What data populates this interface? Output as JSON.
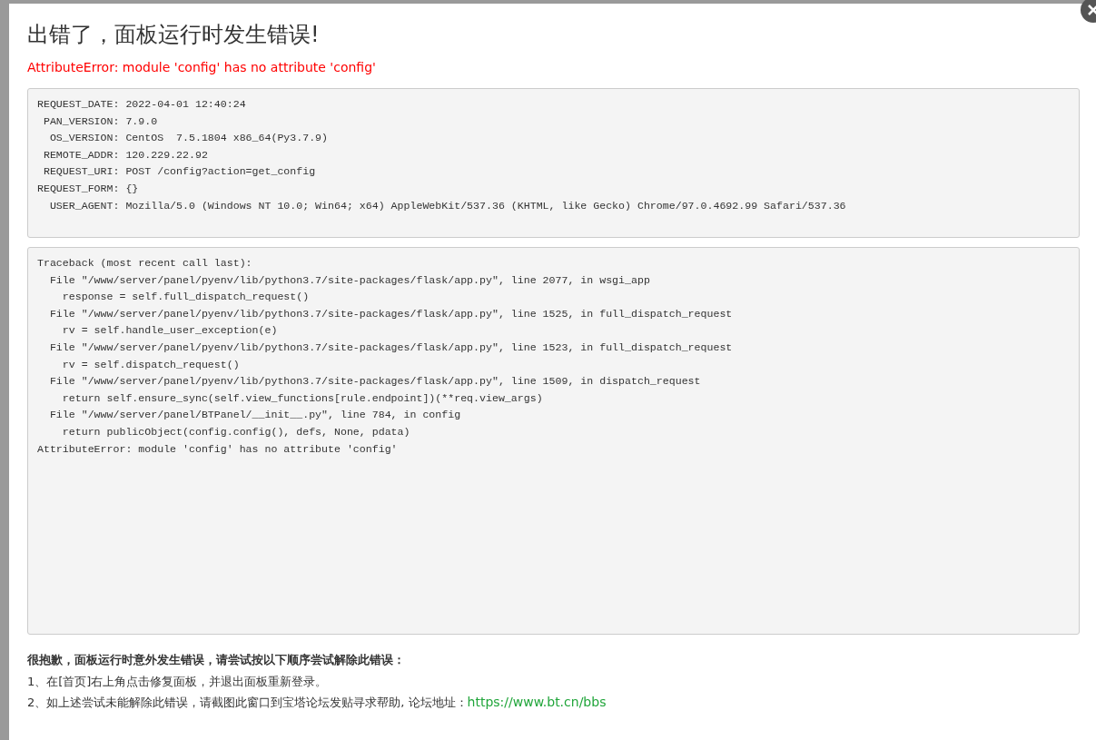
{
  "dialog": {
    "title": "出错了，面板运行时发生错误!",
    "error": "AttributeError: module 'config' has no attribute 'config'"
  },
  "request_info": [
    "REQUEST_DATE: 2022-04-01 12:40:24",
    " PAN_VERSION: 7.9.0",
    "  OS_VERSION: CentOS  7.5.1804 x86_64(Py3.7.9)",
    " REMOTE_ADDR: 120.229.22.92",
    " REQUEST_URI: POST /config?action=get_config",
    "REQUEST_FORM: {}",
    "  USER_AGENT: Mozilla/5.0 (Windows NT 10.0; Win64; x64) AppleWebKit/537.36 (KHTML, like Gecko) Chrome/97.0.4692.99 Safari/537.36"
  ],
  "traceback": [
    "Traceback (most recent call last):",
    "  File \"/www/server/panel/pyenv/lib/python3.7/site-packages/flask/app.py\", line 2077, in wsgi_app",
    "    response = self.full_dispatch_request()",
    "  File \"/www/server/panel/pyenv/lib/python3.7/site-packages/flask/app.py\", line 1525, in full_dispatch_request",
    "    rv = self.handle_user_exception(e)",
    "  File \"/www/server/panel/pyenv/lib/python3.7/site-packages/flask/app.py\", line 1523, in full_dispatch_request",
    "    rv = self.dispatch_request()",
    "  File \"/www/server/panel/pyenv/lib/python3.7/site-packages/flask/app.py\", line 1509, in dispatch_request",
    "    return self.ensure_sync(self.view_functions[rule.endpoint])(**req.view_args)",
    "  File \"/www/server/panel/BTPanel/__init__.py\", line 784, in config",
    "    return publicObject(config.config(), defs, None, pdata)",
    "AttributeError: module 'config' has no attribute 'config'"
  ],
  "help": {
    "heading": "很抱歉，面板运行时意外发生错误，请尝试按以下顺序尝试解除此错误：",
    "steps": [
      {
        "text": "1、在[首页]右上角点击修复面板，并退出面板重新登录。"
      },
      {
        "text": "2、如上述尝试未能解除此错误，请截图此窗口到宝塔论坛发贴寻求帮助, 论坛地址：",
        "link": "https://www.bt.cn/bbs"
      }
    ]
  }
}
